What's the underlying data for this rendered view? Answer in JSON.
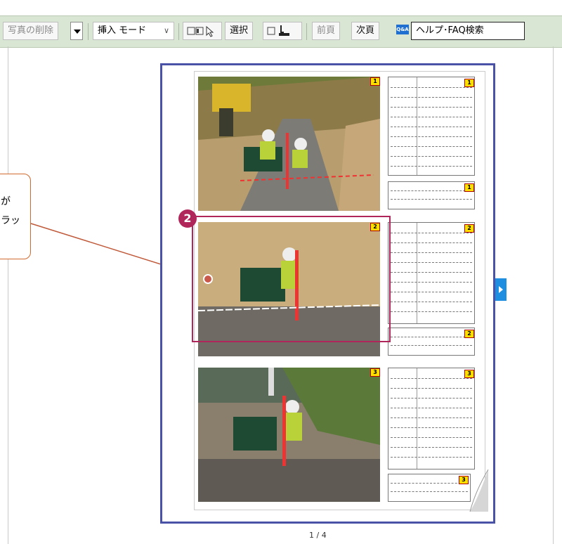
{
  "toolbar": {
    "delete_photo": "写真の削除",
    "mode": "挿入 モード",
    "select": "選択",
    "prev_page": "前頁",
    "next_page": "次頁",
    "qa_badge": "Q&A",
    "help_search": "ヘルプ･FAQ検索"
  },
  "callout": {
    "line1": "が",
    "line2": "ラッ"
  },
  "step": {
    "number": "2"
  },
  "photos": [
    {
      "tag": "1"
    },
    {
      "tag": "2"
    },
    {
      "tag": "3"
    }
  ],
  "pagination": {
    "label": "1 / 4"
  },
  "colors": {
    "toolbar_bg": "#d9e6d4",
    "frame": "#4a52a8",
    "highlight": "#b0265a",
    "callout_border": "#d06a2e"
  }
}
